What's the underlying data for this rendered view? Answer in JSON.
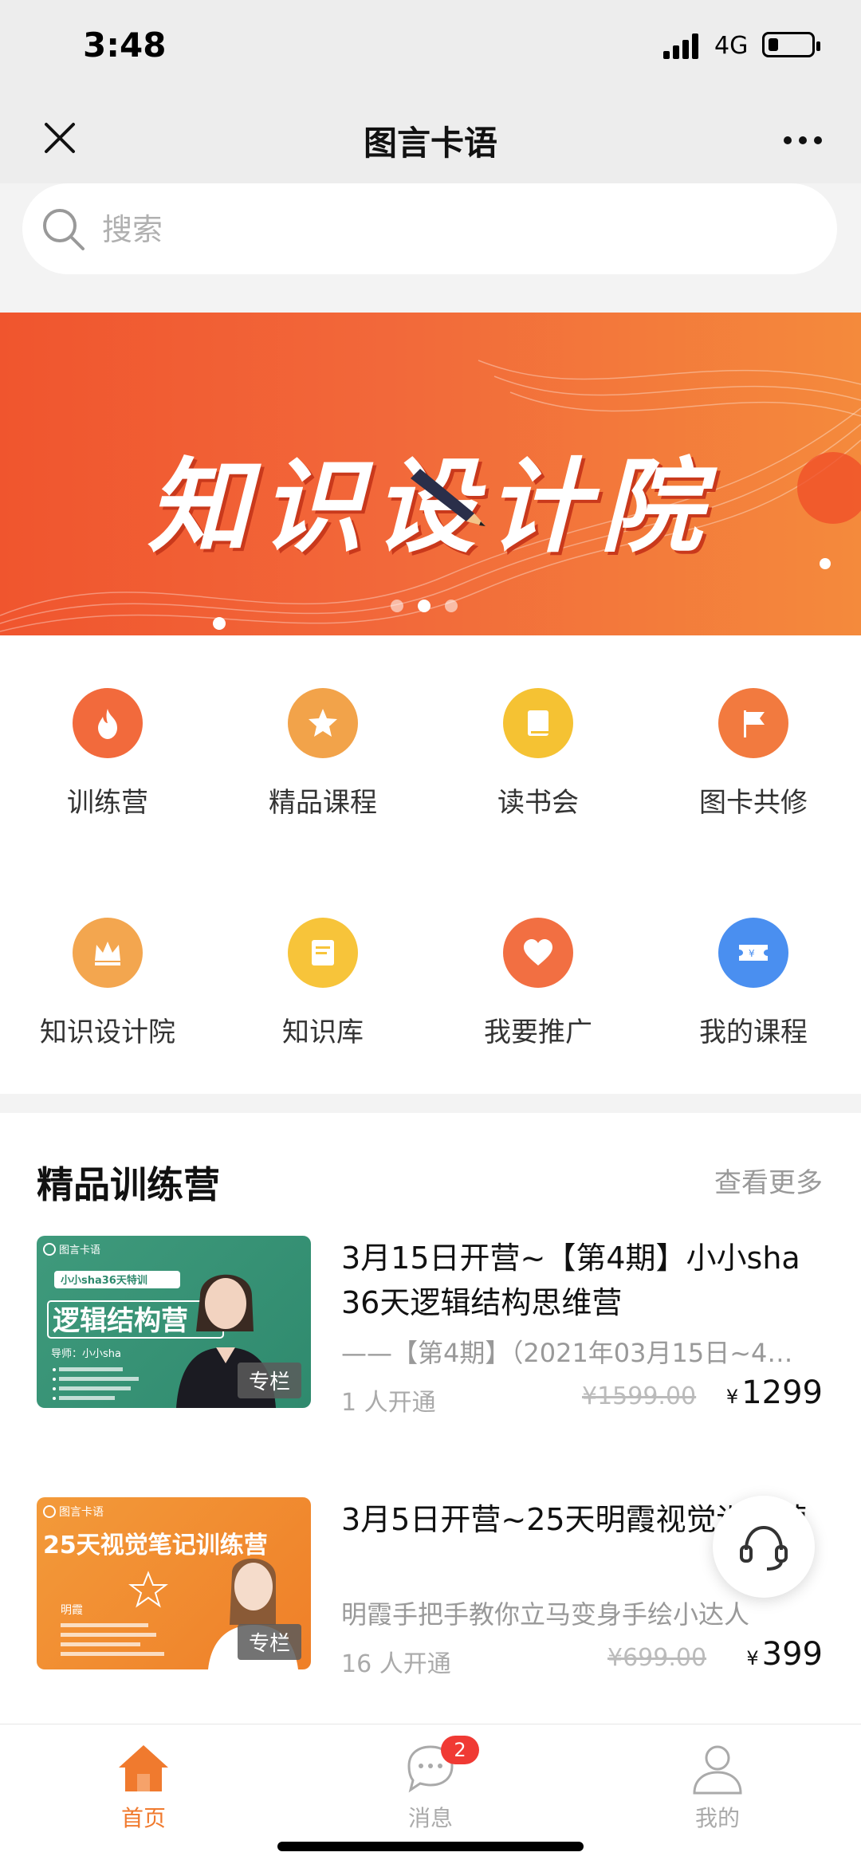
{
  "status_bar": {
    "time": "3:48",
    "network": "4G"
  },
  "nav": {
    "title": "图言卡语"
  },
  "search": {
    "placeholder": "搜索"
  },
  "banner": {
    "title": "知识设计院",
    "slide_count": 3,
    "active_slide": 1
  },
  "grid": {
    "items": [
      {
        "label": "训练营",
        "icon": "flame-icon",
        "color": "#f26a3c"
      },
      {
        "label": "精品课程",
        "icon": "star-icon",
        "color": "#f2a34a"
      },
      {
        "label": "读书会",
        "icon": "book-icon",
        "color": "#f5c233"
      },
      {
        "label": "图卡共修",
        "icon": "flag-icon",
        "color": "#f27a3f"
      },
      {
        "label": "知识设计院",
        "icon": "crown-icon",
        "color": "#f3a64f"
      },
      {
        "label": "知识库",
        "icon": "note-icon",
        "color": "#f7c43a"
      },
      {
        "label": "我要推广",
        "icon": "heart-icon",
        "color": "#f26f42"
      },
      {
        "label": "我的课程",
        "icon": "ticket-icon",
        "color": "#4a8ff0"
      }
    ]
  },
  "section": {
    "title": "精品训练营",
    "more": "查看更多"
  },
  "courses": [
    {
      "title": "3月15日开营~【第4期】小小sha 36天逻辑结构思维营",
      "desc": "——【第4期】（2021年03月15日~4…",
      "buyers": "1 人开通",
      "orig_price": "¥1599.00",
      "price": "1299",
      "tag": "专栏",
      "thumb": {
        "brand": "图言卡语",
        "badge": "小小sha36天特训",
        "headline": "逻辑结构营",
        "mentor": "导师：小小sha",
        "bg": "#3f9a7c"
      }
    },
    {
      "title": "3月5日开营~25天明霞视觉训练营",
      "desc": "明霞手把手教你立马变身手绘小达人",
      "buyers": "16 人开通",
      "orig_price": "¥699.00",
      "price": "399",
      "tag": "专栏",
      "thumb": {
        "brand": "图言卡语",
        "headline": "25天视觉笔记训练营",
        "mentor": "明霞",
        "bg": "#f0822d"
      }
    }
  ],
  "currency": "¥",
  "tabbar": {
    "items": [
      {
        "label": "首页",
        "icon": "home-icon",
        "active": true
      },
      {
        "label": "消息",
        "icon": "message-icon",
        "badge": "2"
      },
      {
        "label": "我的",
        "icon": "user-icon"
      }
    ]
  },
  "colors": {
    "accent": "#f07a2e",
    "banner": "#f0552e",
    "badge": "#f03a34"
  }
}
